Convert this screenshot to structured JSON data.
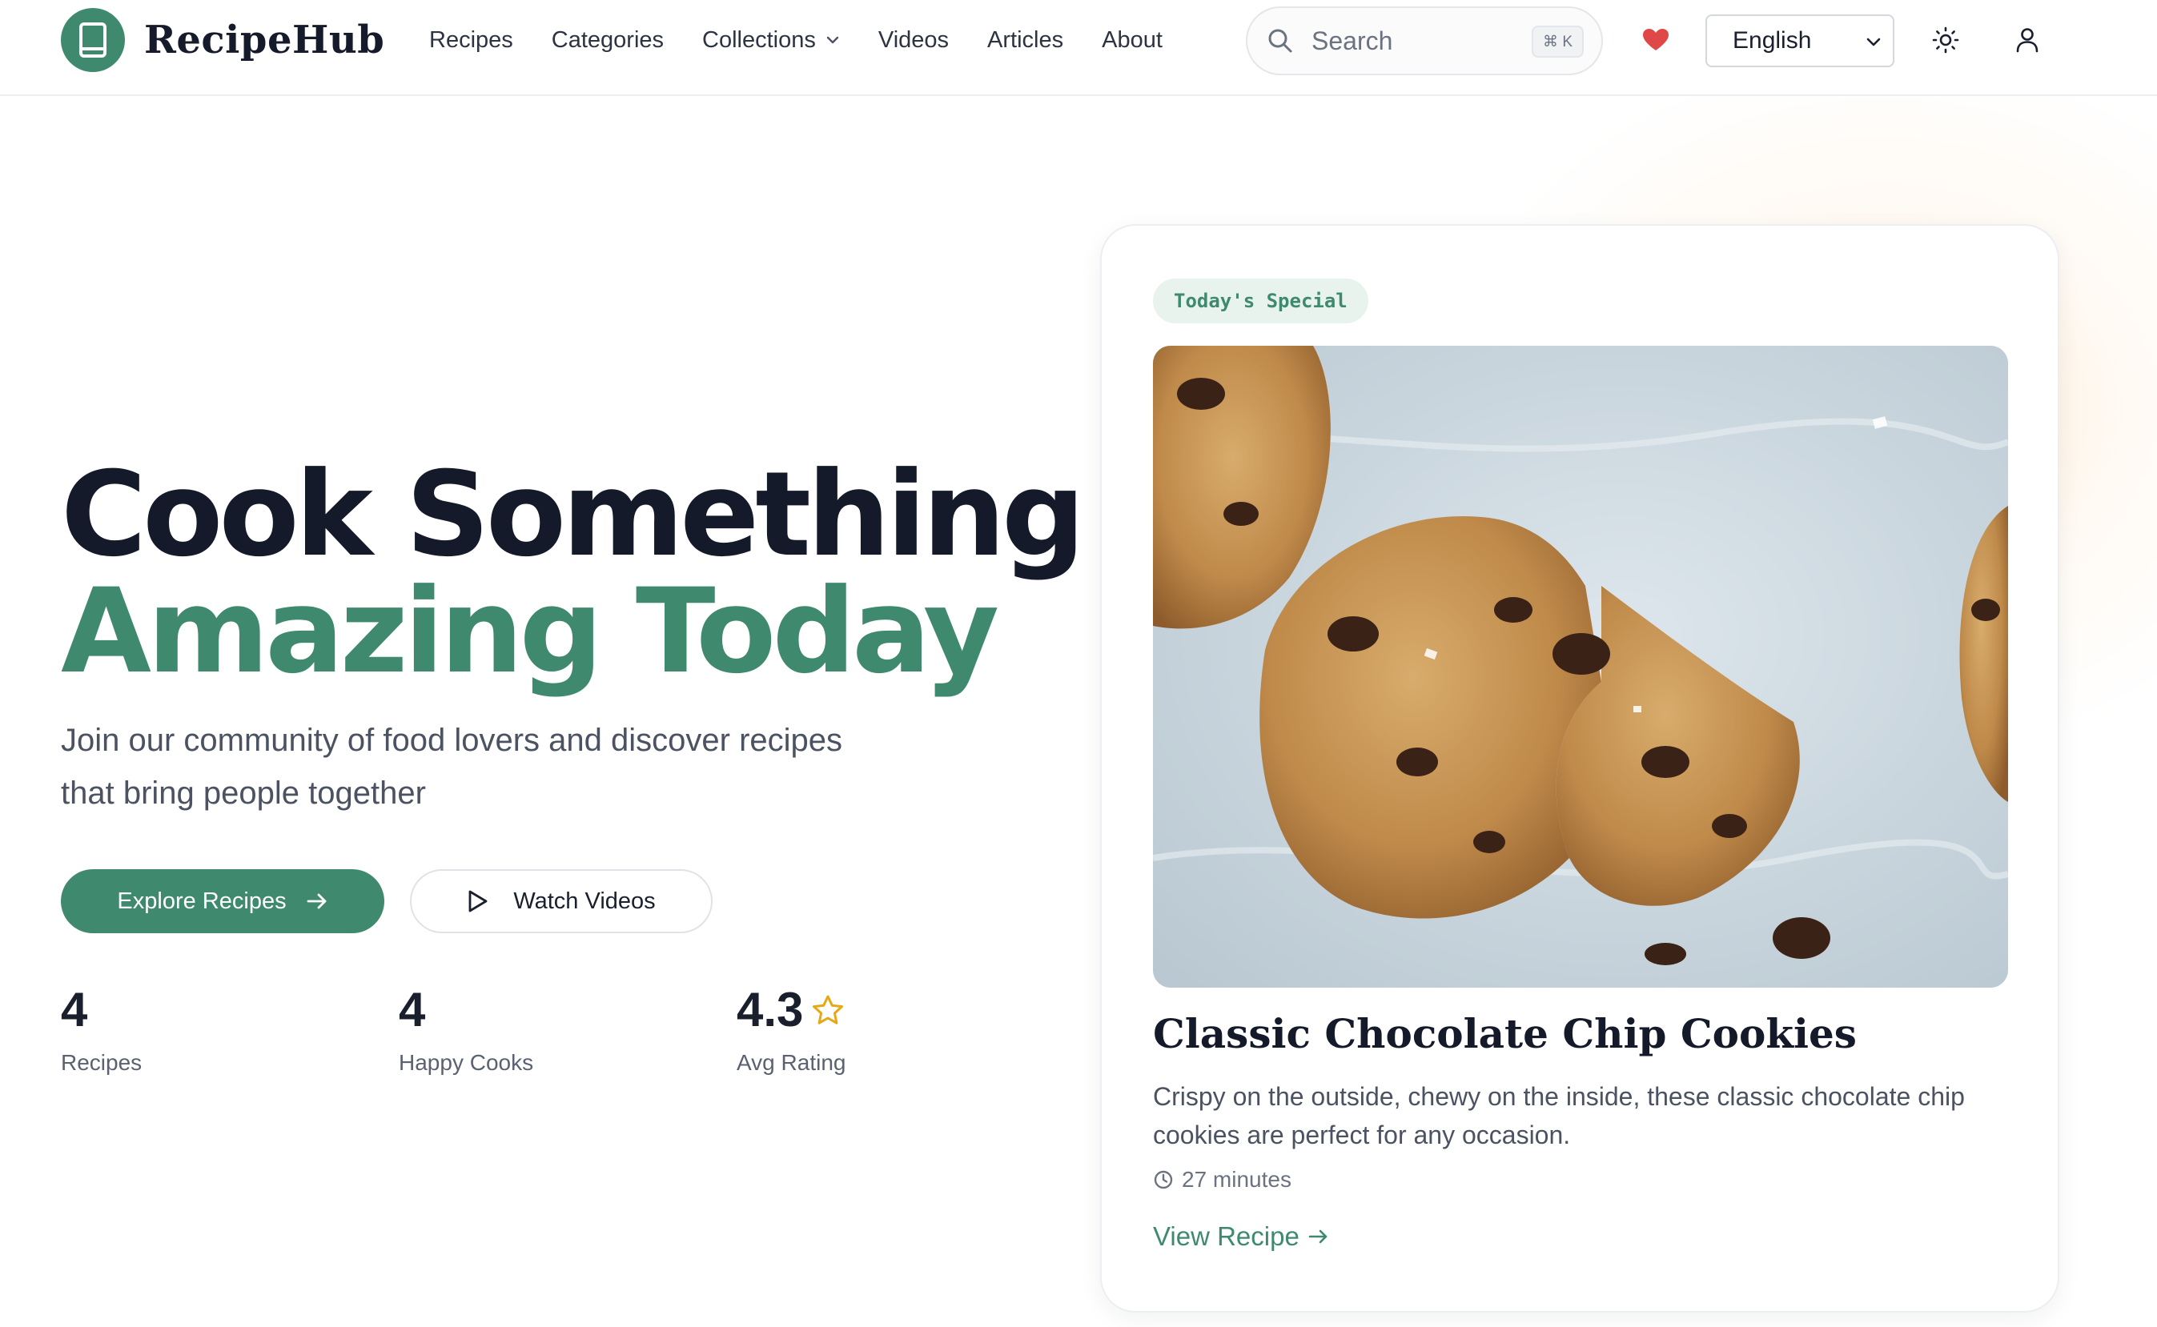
{
  "brand": {
    "name": "RecipeHub",
    "logo_icon": "book-icon",
    "accent": "#3f8a6e"
  },
  "nav": {
    "items": [
      {
        "label": "Recipes"
      },
      {
        "label": "Categories"
      },
      {
        "label": "Collections",
        "has_dropdown": true
      },
      {
        "label": "Videos"
      },
      {
        "label": "Articles"
      },
      {
        "label": "About"
      }
    ]
  },
  "search": {
    "placeholder": "Search",
    "shortcut": "⌘ K"
  },
  "header_actions": {
    "favorites_icon": "heart-icon",
    "favorites_color": "#e04848",
    "language": "English",
    "theme_icon": "sun-icon",
    "account_icon": "user-icon"
  },
  "hero": {
    "title_line1": "Cook Something",
    "title_line2": "Amazing Today",
    "subtitle": "Join our community of food lovers and discover recipes that bring people together",
    "primary_cta": "Explore Recipes",
    "secondary_cta": "Watch Videos",
    "stats": [
      {
        "value": "4",
        "label": "Recipes"
      },
      {
        "value": "4",
        "label": "Happy Cooks"
      },
      {
        "value": "4.3",
        "label": "Avg Rating",
        "icon": "star-icon"
      }
    ]
  },
  "featured": {
    "badge": "Today's Special",
    "title": "Classic Chocolate Chip Cookies",
    "description": "Crispy on the outside, chewy on the inside, these classic chocolate chip cookies are perfect for any occasion.",
    "time": "27 minutes",
    "link": "View Recipe"
  }
}
